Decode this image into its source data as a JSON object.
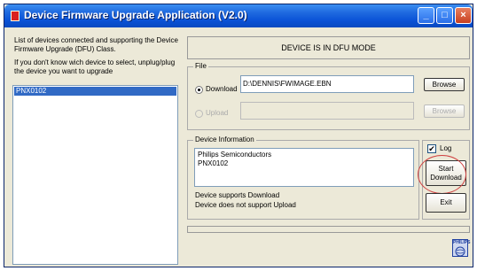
{
  "window": {
    "title": "Device Firmware Upgrade Application (V2.0)"
  },
  "info": {
    "line1": "List of devices connected and supporting the Device Firmware Upgrade (DFU) Class.",
    "line2": "If you don't know wich device to select, unplug/plug the device you want to upgrade"
  },
  "devices": {
    "selected": "PNX0102"
  },
  "status": {
    "mode": "DEVICE IS IN DFU MODE"
  },
  "file": {
    "label": "File",
    "download_label": "Download",
    "download_path": "D:\\DENNIS\\FWIMAGE.EBN",
    "browse_label": "Browse",
    "upload_label": "Upload",
    "upload_path": "",
    "upload_browse_label": "Browse"
  },
  "device_info": {
    "label": "Device Information",
    "manufacturer": "Philips Semiconductors",
    "product": "PNX0102",
    "supports_download": "Device supports Download",
    "supports_upload": "Device does not support Upload"
  },
  "controls": {
    "log_label": "Log",
    "log_checked": true,
    "start_line1": "Start",
    "start_line2": "Download",
    "exit_label": "Exit"
  },
  "logo": {
    "text": "PHILIPS",
    "icon": "philips-shield-icon"
  },
  "colors": {
    "titlebar": "#0a52d6",
    "selection": "#316ac5",
    "highlight_ring": "#d04040"
  }
}
